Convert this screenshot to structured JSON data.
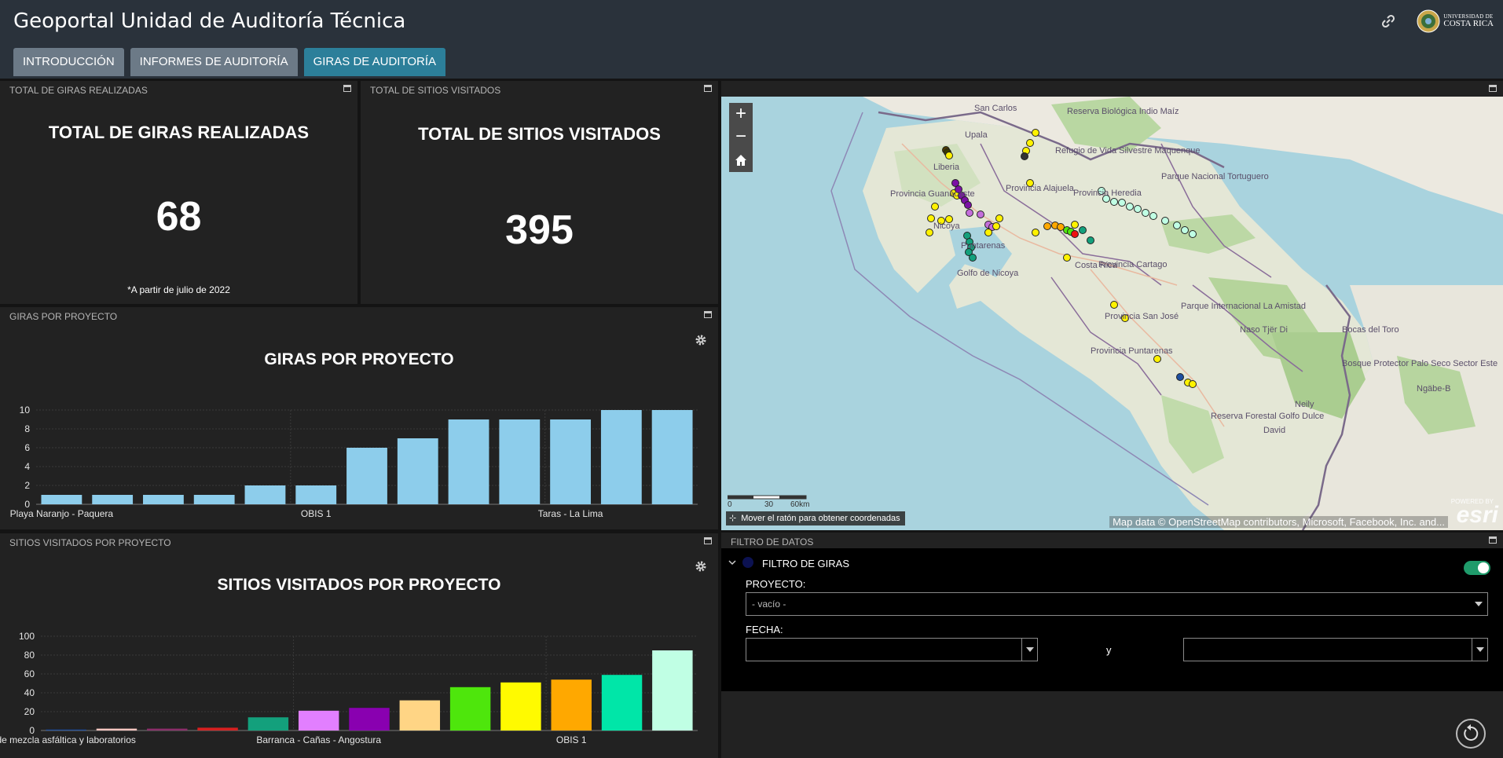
{
  "header": {
    "title": "Geoportal Unidad de Auditoría Técnica",
    "tabs": [
      {
        "label": "INTRODUCCIÓN",
        "active": false
      },
      {
        "label": "INFORMES DE AUDITORÍA",
        "active": false
      },
      {
        "label": "GIRAS DE AUDITORÍA",
        "active": true
      }
    ],
    "logo_small": "UNIVERSIDAD DE",
    "logo_big": "COSTA RICA"
  },
  "panels": {
    "giras_total": {
      "header": "TOTAL DE GIRAS REALIZADAS",
      "title": "TOTAL DE GIRAS REALIZADAS",
      "value": "68",
      "note": "*A partir de julio de 2022"
    },
    "sitios_total": {
      "header": "TOTAL DE SITIOS VISITADOS",
      "title": "TOTAL DE SITIOS VISITADOS",
      "value": "395"
    },
    "giras_chart_header": "GIRAS POR PROYECTO",
    "sitios_chart_header": "SITIOS VISITADOS POR PROYECTO",
    "filter_header": "FILTRO DE DATOS"
  },
  "chart_data": [
    {
      "type": "bar",
      "title": "GIRAS POR PROYECTO",
      "categories": [
        "Playa Naranjo - Paquera",
        "",
        "",
        "",
        "",
        "OBIS 1",
        "",
        "",
        "",
        "",
        "Taras - La Lima",
        "",
        ""
      ],
      "values": [
        1,
        1,
        1,
        1,
        2,
        2,
        6,
        7,
        9,
        9,
        9,
        10,
        10
      ],
      "ylim": [
        0,
        10
      ],
      "yticks": [
        0,
        2,
        4,
        6,
        8,
        10
      ],
      "xlabels_shown": [
        {
          "index": 0,
          "label": "Playa Naranjo - Paquera"
        },
        {
          "index": 5,
          "label": "OBIS 1"
        },
        {
          "index": 10,
          "label": "Taras - La Lima"
        }
      ],
      "bar_color": "#8dcdeb",
      "grid": true
    },
    {
      "type": "bar",
      "title": "SITIOS VISITADOS POR PROYECTO",
      "categories": [
        "Planta de mezcla asfáltica y laboratorios",
        "",
        "",
        "",
        "",
        "Barranca - Cañas - Angostura",
        "",
        "",
        "",
        "",
        "OBIS 1",
        "",
        ""
      ],
      "values": [
        1,
        2,
        2,
        3,
        14,
        21,
        24,
        32,
        46,
        51,
        54,
        59,
        85
      ],
      "ylim": [
        0,
        100
      ],
      "yticks": [
        0,
        20,
        40,
        60,
        80,
        100
      ],
      "xlabels_shown": [
        {
          "index": 0,
          "label": "de mezcla asfáltica y laboratorios"
        },
        {
          "index": 5,
          "label": "Barranca - Cañas - Angostura"
        },
        {
          "index": 10,
          "label": "OBIS 1"
        }
      ],
      "bar_colors": [
        "#1e4fa0",
        "#f7c6c0",
        "#8a2f6a",
        "#d62020",
        "#13a07c",
        "#e27fff",
        "#8900b0",
        "#ffd585",
        "#4ee60c",
        "#fffa00",
        "#ffa800",
        "#00e6a8",
        "#c0ffe4"
      ],
      "grid": true
    }
  ],
  "map": {
    "labels": [
      "San Carlos",
      "Reserva Biológica Indio Maíz",
      "Upala",
      "Liberia",
      "Refugio de Vida Silvestre Maquenque",
      "Parque Nacional Tortuguero",
      "Provincia Alajuela",
      "Provincia Heredia",
      "Provincia Guanacaste",
      "Nicoya",
      "Puntarenas",
      "Golfo de Nicoya",
      "Costa Rica",
      "Provincia Cartago",
      "Provincia San José",
      "Parque Internacional La Amistad",
      "Naso Tjër Di",
      "Bocas del Toro",
      "Provincia Puntarenas",
      "Bosque Protector Palo Seco Sector Este",
      "Ngäbe-B",
      "Neily",
      "Reserva Forestal Golfo Dulce",
      "David"
    ],
    "scale_labels": [
      "0",
      "30",
      "60km"
    ],
    "coords_text": "Mover el ratón para obtener coordenadas",
    "attribution": "Map data © OpenStreetMap contributors, Microsoft, Facebook, Inc. and...",
    "powered": "POWERED BY",
    "esri": "esri"
  },
  "filter": {
    "group_title": "FILTRO DE GIRAS",
    "proyecto_label": "PROYECTO:",
    "proyecto_value": "- vacío -",
    "fecha_label": "FECHA:",
    "y_label": "y",
    "toggle_on": true
  }
}
